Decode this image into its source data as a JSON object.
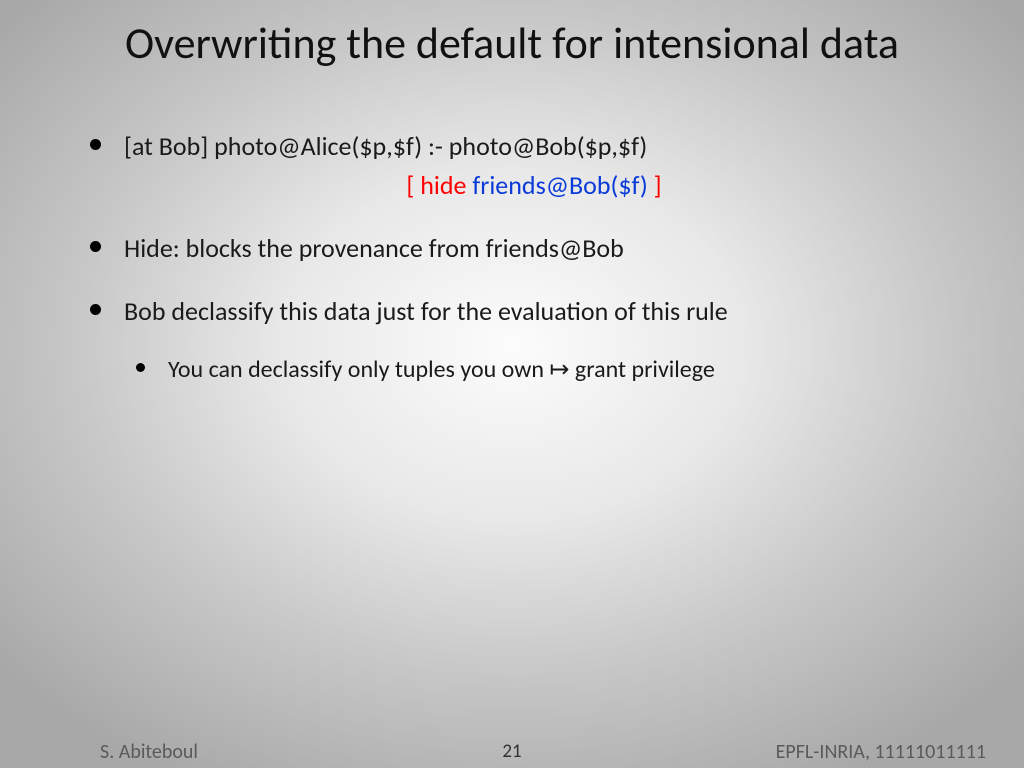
{
  "title": "Overwriting the default for intensional data",
  "bullets": {
    "b1_rule": "[at Bob] photo@Alice($p,$f) :- photo@Bob($p,$f)",
    "b1_sub_open": "[ ",
    "b1_sub_hide": "hide ",
    "b1_sub_friends": "friends@Bob($f)",
    "b1_sub_close": " ]",
    "b2": "Hide: blocks the provenance from friends@Bob",
    "b3": "Bob declassify this data just for the evaluation of this rule",
    "b3_sub": "You can declassify only tuples you own ↦ grant privilege"
  },
  "footer": {
    "author": "S. Abiteboul",
    "page": "21",
    "affil": "EPFL-INRIA,  11111011111"
  }
}
